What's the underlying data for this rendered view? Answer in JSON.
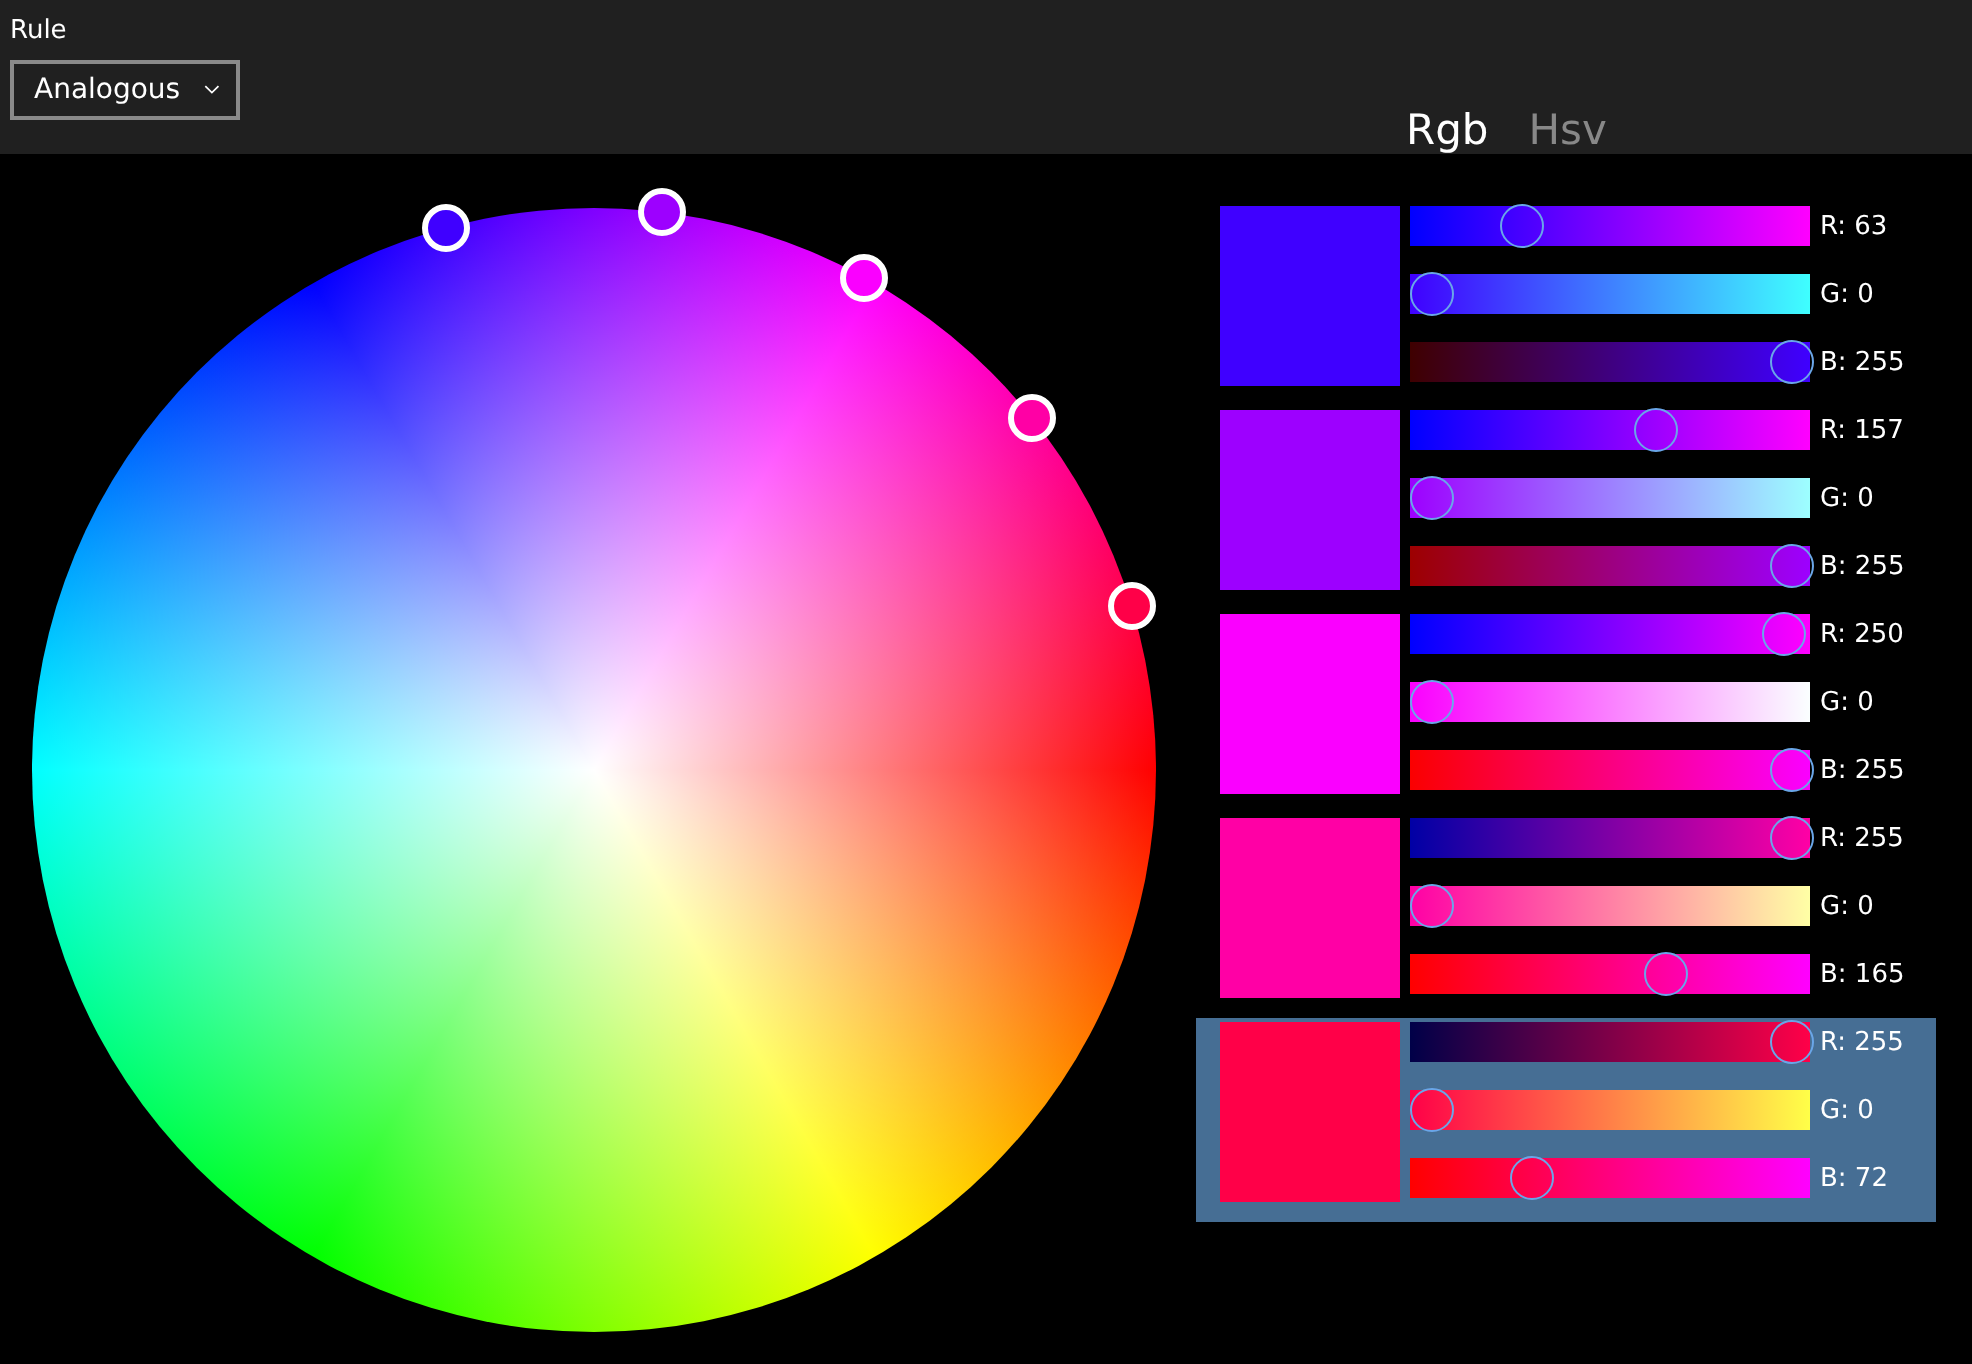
{
  "rule": {
    "label": "Rule",
    "value": "Analogous"
  },
  "tabs": [
    {
      "label": "Rgb",
      "selected": true
    },
    {
      "label": "Hsv",
      "selected": false
    }
  ],
  "colors": [
    {
      "color": "#3f00ff",
      "selected": false,
      "channels": [
        {
          "label": "R: 63",
          "level": 0.25
        },
        {
          "label": "G: 0",
          "level": 0
        },
        {
          "label": "B: 255",
          "level": 1
        }
      ]
    },
    {
      "color": "#9d00ff",
      "selected": false,
      "channels": [
        {
          "label": "R: 157",
          "level": 0.62
        },
        {
          "label": "G: 0",
          "level": 0
        },
        {
          "label": "B: 255",
          "level": 1
        }
      ]
    },
    {
      "color": "#fa00ff",
      "selected": false,
      "channels": [
        {
          "label": "R: 250",
          "level": 0.98
        },
        {
          "label": "G: 0",
          "level": 0
        },
        {
          "label": "B: 255",
          "level": 1
        }
      ]
    },
    {
      "color": "#ff00a5",
      "selected": false,
      "channels": [
        {
          "label": "R: 255",
          "level": 1
        },
        {
          "label": "G: 0",
          "level": 0
        },
        {
          "label": "B: 165",
          "level": 0.65
        }
      ]
    },
    {
      "color": "#ff0048",
      "selected": true,
      "channels": [
        {
          "label": "R: 255",
          "level": 1
        },
        {
          "label": "G: 0",
          "level": 0
        },
        {
          "label": "B: 72",
          "level": 0.28
        }
      ]
    }
  ]
}
